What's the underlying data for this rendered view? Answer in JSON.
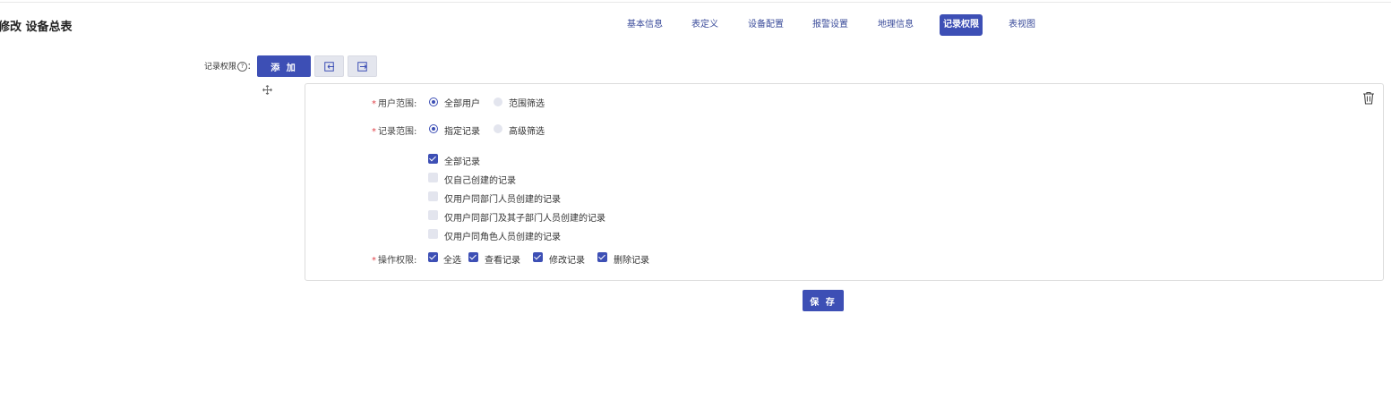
{
  "header": {
    "title": "修改 设备总表"
  },
  "tabs": [
    {
      "label": "基本信息",
      "active": false
    },
    {
      "label": "表定义",
      "active": false
    },
    {
      "label": "设备配置",
      "active": false
    },
    {
      "label": "报警设置",
      "active": false
    },
    {
      "label": "地理信息",
      "active": false
    },
    {
      "label": "记录权限",
      "active": true
    },
    {
      "label": "表视图",
      "active": false
    }
  ],
  "toolbar": {
    "label": "记录权限",
    "label_suffix": "：",
    "help_icon": "question-circle-icon",
    "add_label": "添 加",
    "import_icon": "import-icon",
    "export_icon": "export-icon"
  },
  "rule": {
    "drag_icon": "move-icon",
    "delete_icon": "trash-icon",
    "required_mark": "*",
    "user_scope": {
      "label": "用户范围:",
      "options": [
        {
          "label": "全部用户",
          "selected": true
        },
        {
          "label": "范围筛选",
          "selected": false
        }
      ]
    },
    "record_scope": {
      "label": "记录范围:",
      "options": [
        {
          "label": "指定记录",
          "selected": true
        },
        {
          "label": "高级筛选",
          "selected": false
        }
      ],
      "records": [
        {
          "label": "全部记录",
          "checked": true
        },
        {
          "label": "仅自己创建的记录",
          "checked": false
        },
        {
          "label": "仅用户同部门人员创建的记录",
          "checked": false
        },
        {
          "label": "仅用户同部门及其子部门人员创建的记录",
          "checked": false
        },
        {
          "label": "仅用户同角色人员创建的记录",
          "checked": false
        }
      ]
    },
    "operations": {
      "label": "操作权限:",
      "options": [
        {
          "label": "全选",
          "checked": true
        },
        {
          "label": "查看记录",
          "checked": true
        },
        {
          "label": "修改记录",
          "checked": true
        },
        {
          "label": "删除记录",
          "checked": true
        }
      ]
    }
  },
  "footer": {
    "save_label": "保 存"
  },
  "colors": {
    "primary": "#3d4fb5",
    "required": "#e0434a",
    "unchecked": "#e3e5ee"
  }
}
